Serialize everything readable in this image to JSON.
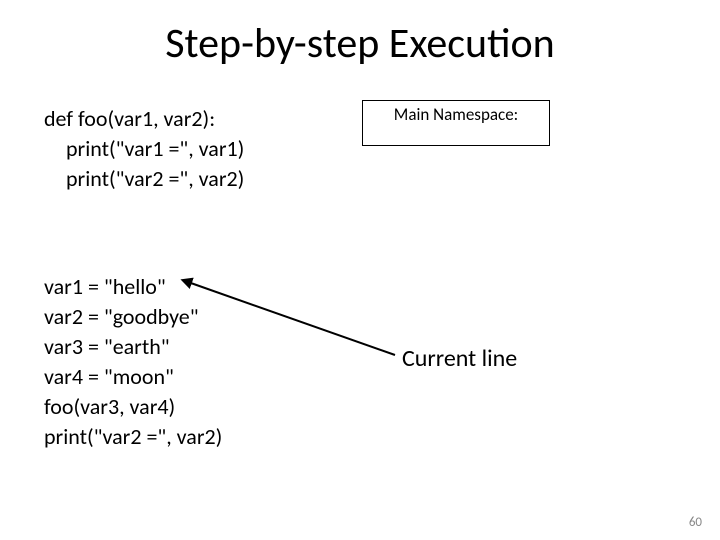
{
  "title": "Step-by-step Execution",
  "code": {
    "def_line": "def foo(var1, var2):",
    "print1": "print(\"var1 =\", var1)",
    "print2": "print(\"var2 =\", var2)",
    "assign1": "var1 = \"hello\"",
    "assign2": "var2 = \"goodbye\"",
    "assign3": "var3 = \"earth\"",
    "assign4": "var4 = \"moon\"",
    "call": "foo(var3, var4)",
    "print_final": "print(\"var2 =\", var2)"
  },
  "namespace_label": "Main Namespace:",
  "current_line_label": "Current line",
  "page_number": "60"
}
